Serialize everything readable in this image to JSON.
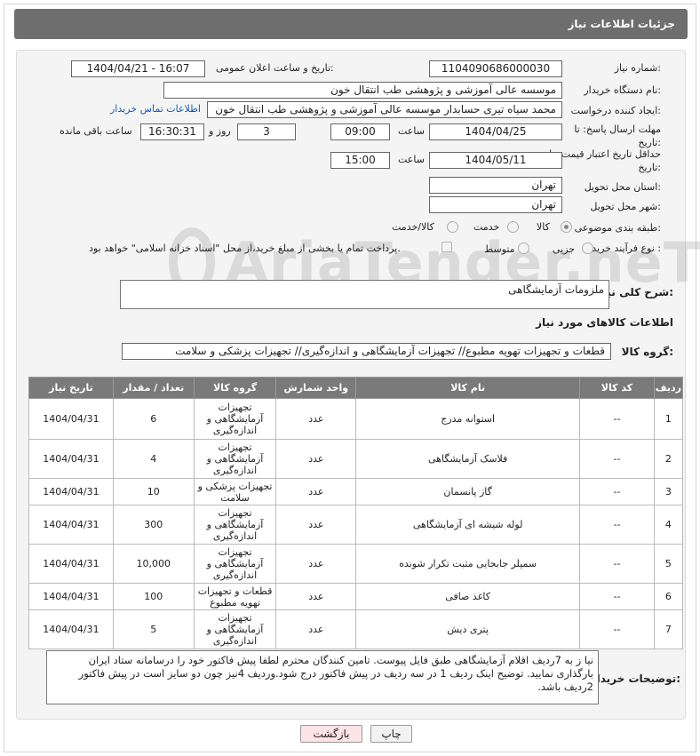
{
  "header": {
    "title": "جزئیات اطلاعات نیاز"
  },
  "form": {
    "need_number_label": "شماره نیاز:",
    "need_number": "1104090686000030",
    "announce_label": "تاریخ و ساعت اعلان عمومی:",
    "announce_value": "1404/04/21 - 16:07",
    "buyer_org_label": "نام دستگاه خریدار:",
    "buyer_org": "موسسه عالی آموزشی و پژوهشی طب انتقال خون",
    "creator_label": "ایجاد کننده درخواست:",
    "creator": "محمد سیاه تیری حسابدار موسسه عالی آموزشی و پژوهشی طب انتقال خون",
    "contact_link": "اطلاعات تماس خریدار",
    "reply_deadline_label": "مهلت ارسال پاسخ: تا تاریخ:",
    "reply_date": "1404/04/25",
    "time_label": "ساعت",
    "reply_time": "09:00",
    "days_value": "3",
    "days_label": "روز و",
    "remaining_time": "16:30:31",
    "remaining_label": "ساعت باقی مانده",
    "price_deadline_label": "حداقل تاریخ اعتبار قیمت: تا تاریخ:",
    "price_date": "1404/05/11",
    "price_time": "15:00",
    "province_label": "استان محل تحویل:",
    "province": "تهران",
    "city_label": "شهر محل تحویل:",
    "city": "تهران",
    "category_label": "طبقه بندی موضوعی:",
    "category_options": [
      "کالا",
      "خدمت",
      "کالا/خدمت"
    ],
    "process_label": "نوع فرآیند خرید :",
    "process_options": [
      "جزیی",
      "متوسط"
    ],
    "payment_note": "پرداخت تمام یا بخشی از مبلغ خرید،از محل \"اسناد خزانه اسلامی\" خواهد بود.",
    "summary_label": "شرح کلی نیاز:",
    "summary": "ملزومات آزمایشگاهی",
    "goods_info_title": "اطلاعات کالاهای مورد نیاز",
    "goods_group_label": "گروه کالا:",
    "goods_group": "قطعات و تجهیزات تهویه مطبوع// تجهیزات آزمایشگاهی و اندازه‌گیری// تجهیزات پزشکی و سلامت",
    "buyer_notes_label": "توضیحات خریدار:",
    "buyer_notes": "نیا ز به 7ردیف اقلام آزمایشگاهی طبق فایل پیوست. تامین کنندگان محترم لطفا پیش فاکتور خود را درسامانه ستاد ایران بارگذاری نمایید. توضیح اینک ردیف 1 در سه ردیف در پیش فاکتور درج شود.وردیف 4نیز چون دو سایز است در پیش فاکتور 2ردیف باشد."
  },
  "table": {
    "headers": [
      "ردیف",
      "کد کالا",
      "نام کالا",
      "واحد شمارش",
      "گروه کالا",
      "تعداد / مقدار",
      "تاریخ نیاز"
    ],
    "rows": [
      [
        "1",
        "--",
        "استوانه مدرج",
        "عدد",
        "تجهیزات آزمایشگاهی و اندازه‌گیری",
        "6",
        "1404/04/31"
      ],
      [
        "2",
        "--",
        "فلاسک آزمایشگاهی",
        "عدد",
        "تجهیزات آزمایشگاهی و اندازه‌گیری",
        "4",
        "1404/04/31"
      ],
      [
        "3",
        "--",
        "گاز پانسمان",
        "عدد",
        "تجهیزات پزشکی و سلامت",
        "10",
        "1404/04/31"
      ],
      [
        "4",
        "--",
        "لوله شیشه ای آزمایشگاهی",
        "عدد",
        "تجهیزات آزمایشگاهی و اندازه‌گیری",
        "300",
        "1404/04/31"
      ],
      [
        "5",
        "--",
        "سمپلر جابجایی مثبت تکرار شونده",
        "عدد",
        "تجهیزات آزمایشگاهی و اندازه‌گیری",
        "10,000",
        "1404/04/31"
      ],
      [
        "6",
        "--",
        "کاغذ صافی",
        "عدد",
        "قطعات و تجهیزات تهویه مطبوع",
        "100",
        "1404/04/31"
      ],
      [
        "7",
        "--",
        "پتری دیش",
        "عدد",
        "تجهیزات آزمایشگاهی و اندازه‌گیری",
        "5",
        "1404/04/31"
      ]
    ]
  },
  "buttons": {
    "print": "چاپ",
    "back": "بازگشت"
  },
  "watermark": "AriaTender.neT"
}
